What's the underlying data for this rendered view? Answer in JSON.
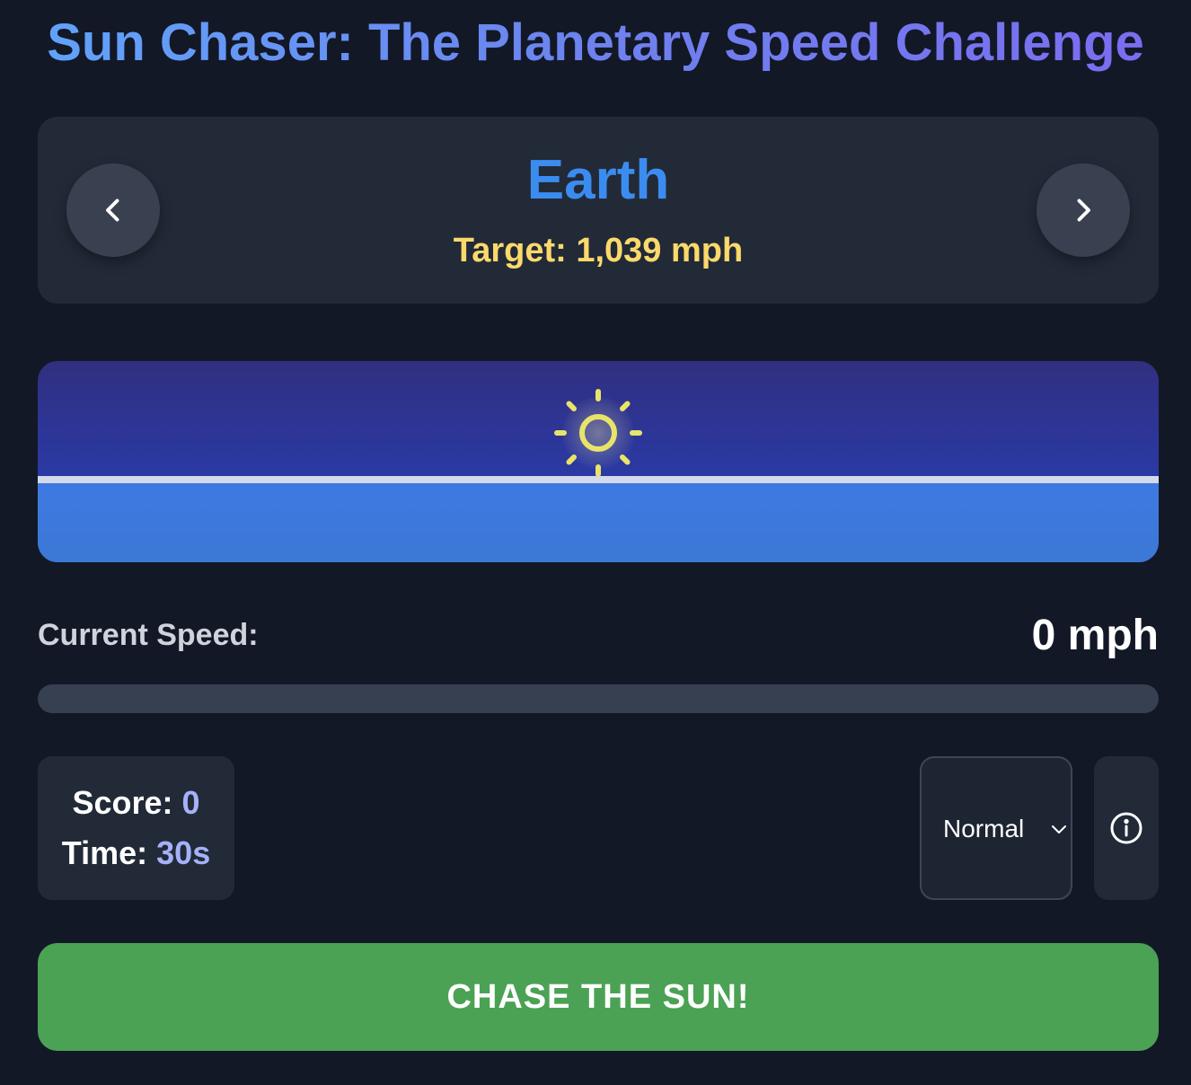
{
  "app": {
    "title": "Sun Chaser: The Planetary Speed Challenge"
  },
  "planet": {
    "name": "Earth",
    "target_label": "Target: 1,039 mph",
    "prev_icon": "chevron-left-icon",
    "next_icon": "chevron-right-icon"
  },
  "scene": {
    "sun_icon": "sun-icon",
    "sky_color": "#2a3aa6",
    "ground_color": "#3c78d4",
    "sun_color": "#e8e46a"
  },
  "speed": {
    "label": "Current Speed:",
    "value": "0 mph",
    "progress_percent": 0
  },
  "stats": {
    "score_label": "Score:",
    "score_value": "0",
    "time_label": "Time:",
    "time_value": "30s"
  },
  "difficulty": {
    "selected": "Normal",
    "icon": "chevron-down-icon"
  },
  "info": {
    "icon": "info-icon"
  },
  "actions": {
    "chase_label": "CHASE THE SUN!",
    "chase_color": "#4ba254"
  }
}
